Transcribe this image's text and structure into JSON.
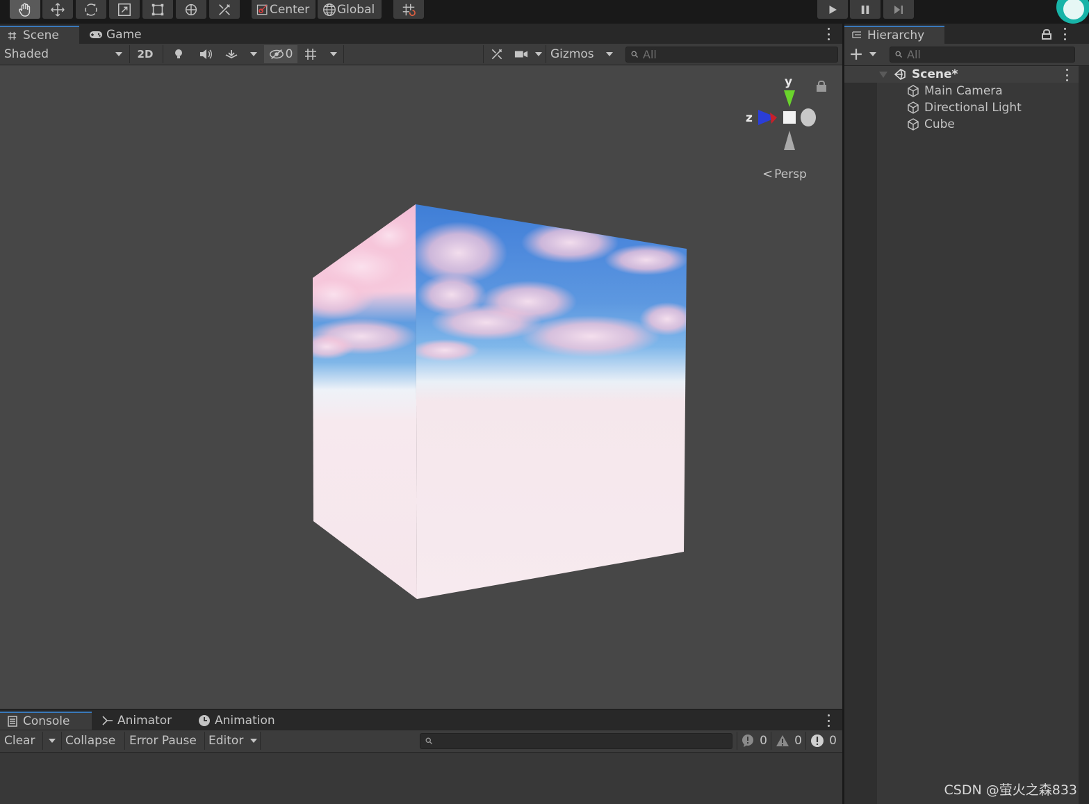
{
  "toolbar": {
    "tools": [
      "hand-tool",
      "move-tool",
      "rotate-tool",
      "scale-tool",
      "rect-tool",
      "transform-tool",
      "custom-tool"
    ],
    "pivot_label": "Center",
    "space_label": "Global"
  },
  "scene": {
    "tabs": [
      "Scene",
      "Game"
    ],
    "shading_mode": "Shaded",
    "toggle_2d": "2D",
    "hidden_count": "0",
    "gizmos_label": "Gizmos",
    "search_placeholder": "All",
    "gizmo": {
      "axis_y": "y",
      "axis_z": "z",
      "projection": "Persp"
    }
  },
  "console": {
    "tabs": [
      "Console",
      "Animator",
      "Animation"
    ],
    "clear_label": "Clear",
    "collapse_label": "Collapse",
    "error_pause_label": "Error Pause",
    "editor_label": "Editor",
    "counts": {
      "messages": "0",
      "warnings": "0",
      "errors": "0"
    }
  },
  "hierarchy": {
    "title": "Hierarchy",
    "search_placeholder": "All",
    "scene_name": "Scene*",
    "items": [
      "Main Camera",
      "Directional Light",
      "Cube"
    ]
  },
  "watermark": "CSDN @萤火之森833",
  "colors": {
    "sky_blue": "#4a86d8",
    "cloud_pink": "#f6c6da",
    "floor_pink": "#f5e6ea",
    "accent": "#3a79bb"
  }
}
